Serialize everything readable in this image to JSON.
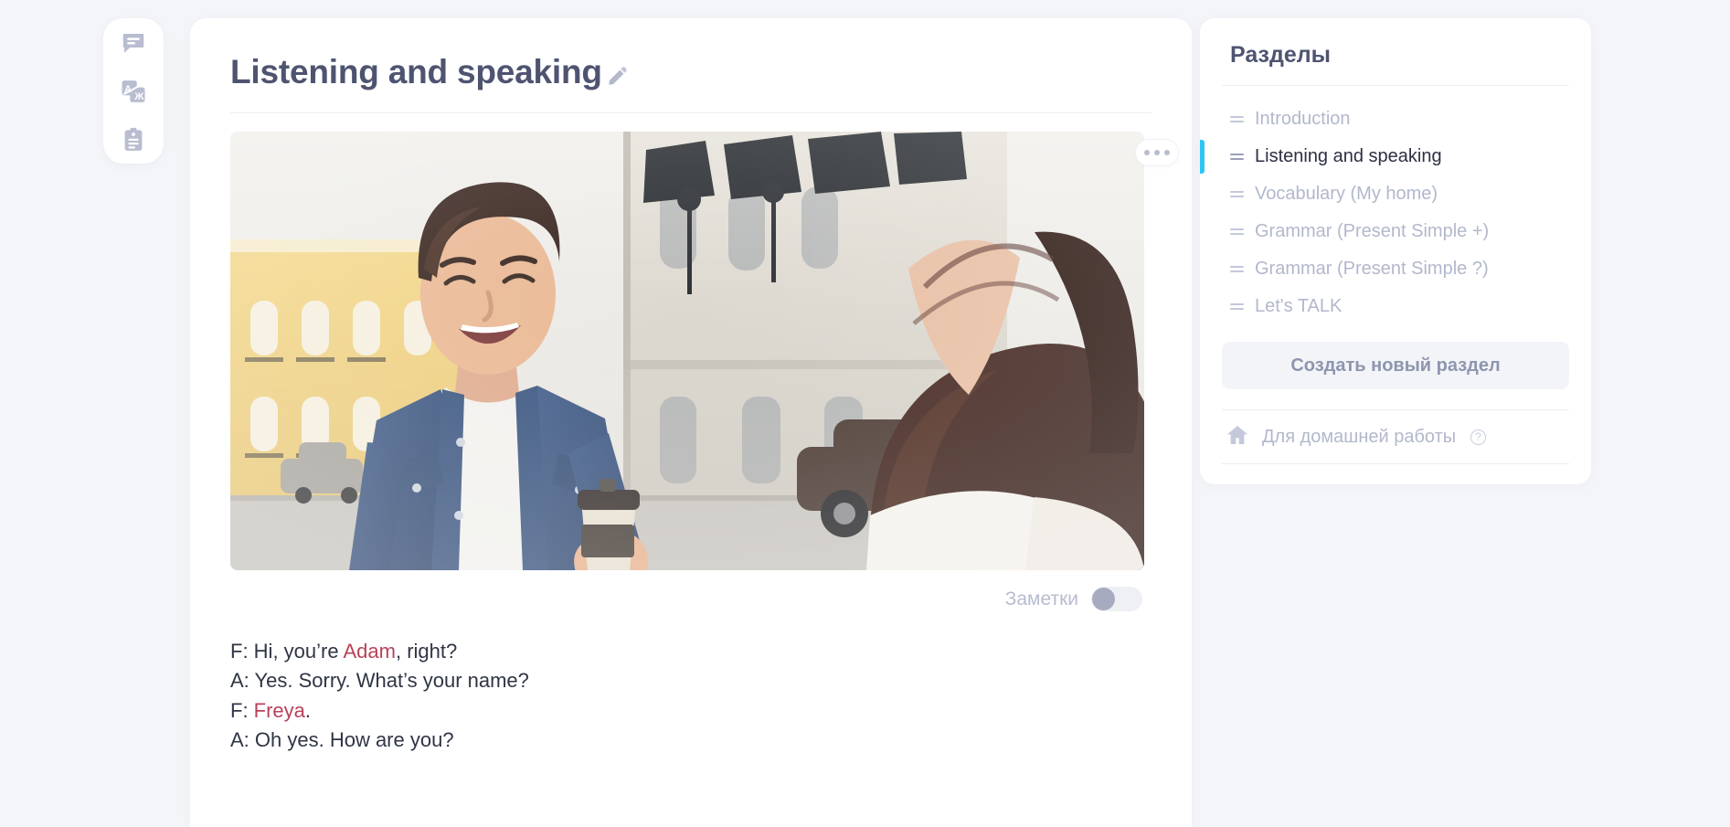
{
  "theme": {
    "page_background": "#f4f5f9",
    "card_background": "#ffffff",
    "title_color": "#4e5470",
    "muted_color": "#b2b8cc",
    "active_accent": "#2ec5f5",
    "highlight_name_color": "#b8425a"
  },
  "rail": {
    "items": [
      {
        "icon": "chat-bubble-icon",
        "name": "chat"
      },
      {
        "icon": "translate-icon",
        "name": "translate"
      },
      {
        "icon": "clipboard-icon",
        "name": "notes"
      }
    ]
  },
  "lesson": {
    "title": "Listening and speaking",
    "edit_icon": "pencil-icon",
    "more_icon": "ellipsis-icon",
    "image": {
      "alt": "Smiling man in denim shirt holding a coffee cup talking with a woman with long brown curly hair on a European city street"
    },
    "notes": {
      "label": "Заметки",
      "enabled": false
    },
    "dialogue": [
      {
        "prefix": "F: Hi, you’re ",
        "name": "Adam",
        "suffix": ", right?"
      },
      {
        "prefix": "A: Yes. Sorry. What’s your name?",
        "name": "",
        "suffix": ""
      },
      {
        "prefix": "F: ",
        "name": "Freya",
        "suffix": "."
      },
      {
        "prefix": "A: Oh yes. How are you?",
        "name": "",
        "suffix": ""
      }
    ]
  },
  "sections_panel": {
    "title": "Разделы",
    "items": [
      {
        "label": "Introduction",
        "active": false
      },
      {
        "label": "Listening and speaking",
        "active": true
      },
      {
        "label": "Vocabulary (My home)",
        "active": false
      },
      {
        "label": "Grammar (Present Simple +)",
        "active": false
      },
      {
        "label": "Grammar (Present Simple ?)",
        "active": false
      },
      {
        "label": "Let's TALK",
        "active": false
      }
    ],
    "create_button": "Создать новый раздел",
    "homework": {
      "icon": "home-icon",
      "label": "Для домашней работы",
      "help_icon": "question-mark-icon",
      "help_glyph": "?"
    }
  }
}
